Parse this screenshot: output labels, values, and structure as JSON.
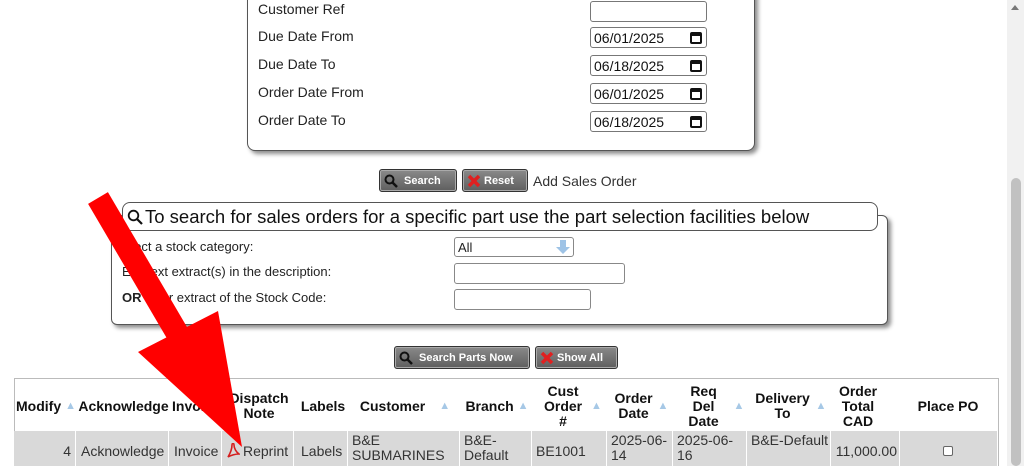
{
  "criteria": {
    "rows": [
      {
        "label": "Customer Ref",
        "value": ""
      },
      {
        "label": "Due Date From",
        "value": "06/01/2025"
      },
      {
        "label": "Due Date To",
        "value": "06/18/2025"
      },
      {
        "label": "Order Date From",
        "value": "06/01/2025"
      },
      {
        "label": "Order Date To",
        "value": "06/18/2025"
      }
    ]
  },
  "actions": {
    "search_label": "Search",
    "reset_label": "Reset",
    "add_sales_order": "Add Sales Order"
  },
  "part_search": {
    "legend": "To search for sales orders for a specific part use the part selection facilities below",
    "category_label": "elect a stock category:",
    "category_value": "All",
    "description_label": "text extract(s) in the description:",
    "description_prefix": "E",
    "stock_code_prefix": "OR",
    "stock_code_label": "ter extract of the Stock Code:",
    "search_parts_label": "Search Parts Now",
    "show_all_label": "Show All"
  },
  "table": {
    "headers": {
      "modify": "Modify",
      "acknowledge": "Acknowledge",
      "invoice": "Invoi",
      "dispatch_note": "Dispatch Note",
      "labels": "Labels",
      "customer": "Customer",
      "branch": "Branch",
      "cust_order": "Cust Order #",
      "order_date": "Order Date",
      "req_del_date": "Req Del Date",
      "delivery_to": "Delivery To",
      "order_total": "Order Total CAD",
      "place_po": "Place PO"
    },
    "row": {
      "modify": "4",
      "acknowledge": "Acknowledge",
      "invoice": "Invoice",
      "dispatch_note": "Reprint",
      "labels": "Labels",
      "customer": "B&E SUBMARINES",
      "branch": "B&E-Default",
      "cust_order": "BE1001",
      "order_date": "2025-06-14",
      "req_del_date": "2025-06-16",
      "delivery_to": "B&E-Default",
      "order_total": "11,000.00"
    }
  },
  "colors": {
    "button_bg": "#6b6b6b",
    "row_bg": "#d9d9d9",
    "sort_arrow": "#a6c8e6",
    "annotation_arrow": "#ff0000",
    "reset_x": "#e02020",
    "pdf_icon": "#d42020"
  },
  "icons": [
    "search-icon",
    "reset-x-icon",
    "calendar-icon",
    "dropdown-arrow-icon",
    "pdf-icon",
    "sort-arrow-icon",
    "red-annotation-arrow"
  ]
}
